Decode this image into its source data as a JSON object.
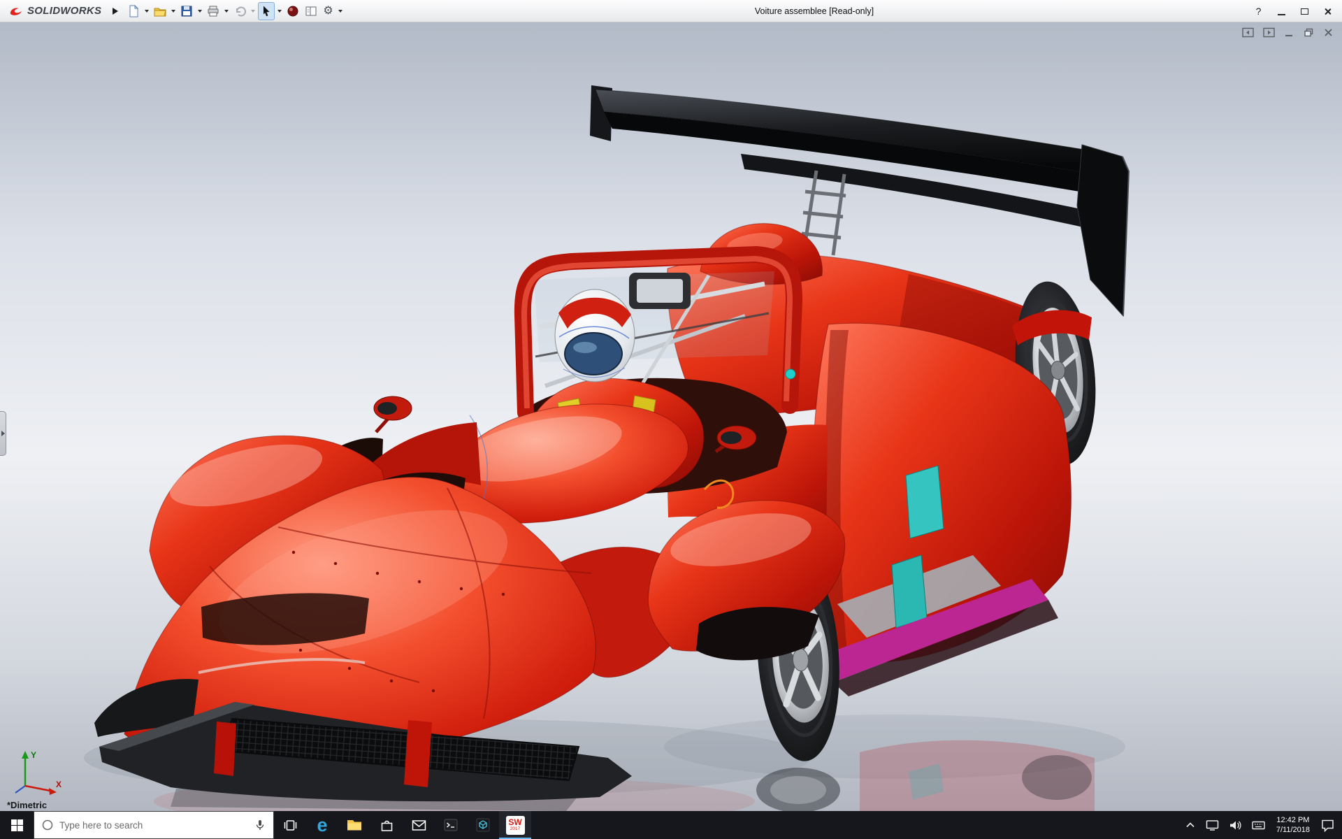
{
  "app": {
    "brand": "SOLIDWORKS",
    "title": "Voiture assemblee [Read-only]"
  },
  "titlebar": {
    "help_glyph": "?",
    "gear_glyph": "⚙",
    "toolbar_icon_names": [
      "flyout-arrow",
      "new-document",
      "open-document",
      "save",
      "print",
      "undo",
      "select-cursor",
      "edit-appearance",
      "display-pane",
      "options-gear"
    ],
    "window_control_names": [
      "help",
      "minimize",
      "maximize",
      "close"
    ]
  },
  "document_window": {
    "control_icon_names": [
      "collapse-pane-left",
      "collapse-pane-right",
      "minimize",
      "restore",
      "close"
    ]
  },
  "viewport": {
    "view_orientation_label": "*Dimetric",
    "triad": {
      "x_label": "X",
      "y_label": "Y"
    },
    "model_colors": {
      "body_red": "#d42015",
      "wing_black": "#101214",
      "window_teal": "#35c4bf",
      "sill_magenta": "#bb2693",
      "rim_silver": "#d6d9dd"
    }
  },
  "taskbar": {
    "search_placeholder": "Type here to search",
    "icon_names": [
      "start",
      "search-ring",
      "microphone",
      "task-view",
      "edge",
      "file-explorer",
      "store",
      "mail",
      "command-prompt",
      "3d-builder",
      "solidworks-2017"
    ],
    "edge_glyph": "e",
    "solidworks_label": "SW",
    "solidworks_year": "2017",
    "tray_icon_names": [
      "hidden-icons-chevron",
      "network",
      "volume",
      "touch-keyboard",
      "action-center"
    ],
    "clock_time": "12:42 PM",
    "clock_date": "7/11/2018"
  }
}
